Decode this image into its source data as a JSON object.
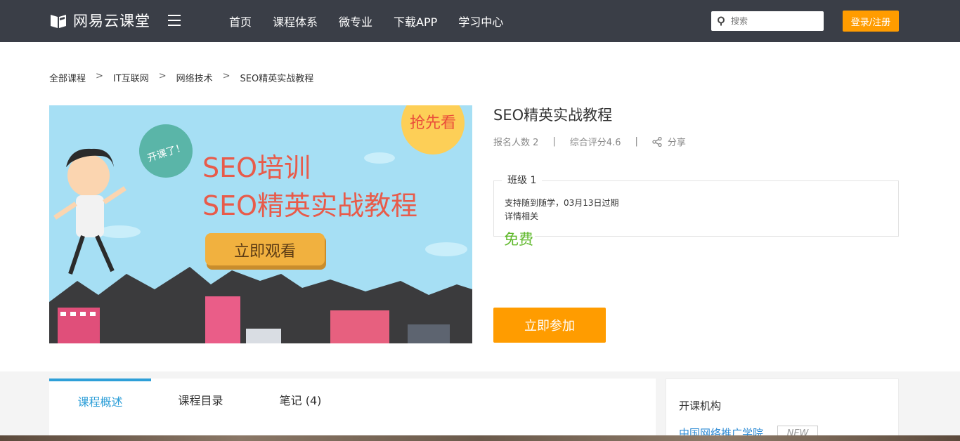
{
  "header": {
    "logo_text": "网易云课堂",
    "nav": [
      "首页",
      "课程体系",
      "微专业",
      "下载APP",
      "学习中心"
    ],
    "search_placeholder": "搜索",
    "login_label": "登录/注册"
  },
  "breadcrumb": {
    "items": [
      "全部课程",
      "IT互联网",
      "网络技术",
      "SEO精英实战教程"
    ],
    "separator": ">"
  },
  "banner": {
    "badge_text": "开课了！",
    "corner_text": "抢先看",
    "line1": "SEO培训",
    "line2": "SEO精英实战教程",
    "cta": "立即观看"
  },
  "course": {
    "title": "SEO精英实战教程",
    "enrolled": "报名人数 2",
    "rating": "综合评分4.6",
    "share": "分享",
    "class_name": "班级 1",
    "class_info": "支持随到随学，03月13日过期",
    "class_detail": "详情相关",
    "price": "免费",
    "join_label": "立即参加"
  },
  "tabs": [
    {
      "label": "课程概述",
      "active": true
    },
    {
      "label": "课程目录",
      "active": false
    },
    {
      "label": "笔记 (4)",
      "active": false
    }
  ],
  "sidebar": {
    "title": "开课机构",
    "org_name": "中国网络推广学院",
    "badge": "NEW"
  },
  "colors": {
    "topbar": "#3a3e47",
    "accent_orange": "#ff9c00",
    "price_green": "#5fb82b",
    "tab_blue": "#2e9fd8"
  }
}
